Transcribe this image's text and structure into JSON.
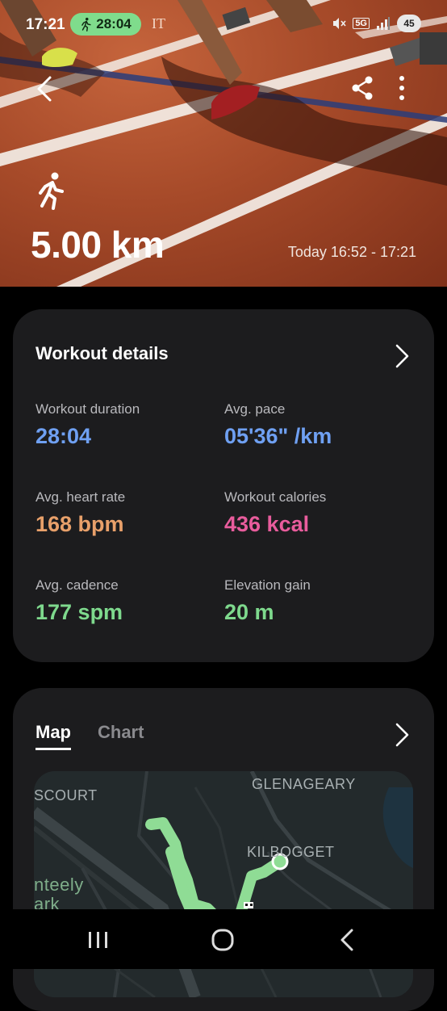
{
  "status_bar": {
    "time": "17:21",
    "workout_timer": "28:04",
    "carrier": "IT",
    "network": "5G",
    "battery": "45"
  },
  "hero": {
    "distance": "5.00 km",
    "date_range": "Today 16:52 - 17:21",
    "icons": [
      "back-arrow-icon",
      "share-icon",
      "more-vert-icon",
      "running-icon"
    ]
  },
  "details": {
    "title": "Workout details",
    "metrics": [
      {
        "label": "Workout duration",
        "value": "28:04",
        "color": "#6fa0f2"
      },
      {
        "label": "Avg. pace",
        "value": "05'36\" /km",
        "color": "#6fa0f2"
      },
      {
        "label": "Avg. heart rate",
        "value": "168 bpm",
        "color": "#e8a06a"
      },
      {
        "label": "Workout calories",
        "value": "436 kcal",
        "color": "#e85c9c"
      },
      {
        "label": "Avg. cadence",
        "value": "177 spm",
        "color": "#7ed98d"
      },
      {
        "label": "Elevation gain",
        "value": "20 m",
        "color": "#7ed98d"
      }
    ]
  },
  "map_card": {
    "tabs": [
      "Map",
      "Chart"
    ],
    "active_tab": "Map",
    "map_labels": [
      "SCOURT",
      "GLENAGEARY",
      "KILBOGGET",
      "nteely",
      "ark"
    ],
    "route_color": "#8fdc95"
  },
  "nav_bar": {
    "icons": [
      "recent-apps-icon",
      "home-icon",
      "back-icon"
    ]
  }
}
